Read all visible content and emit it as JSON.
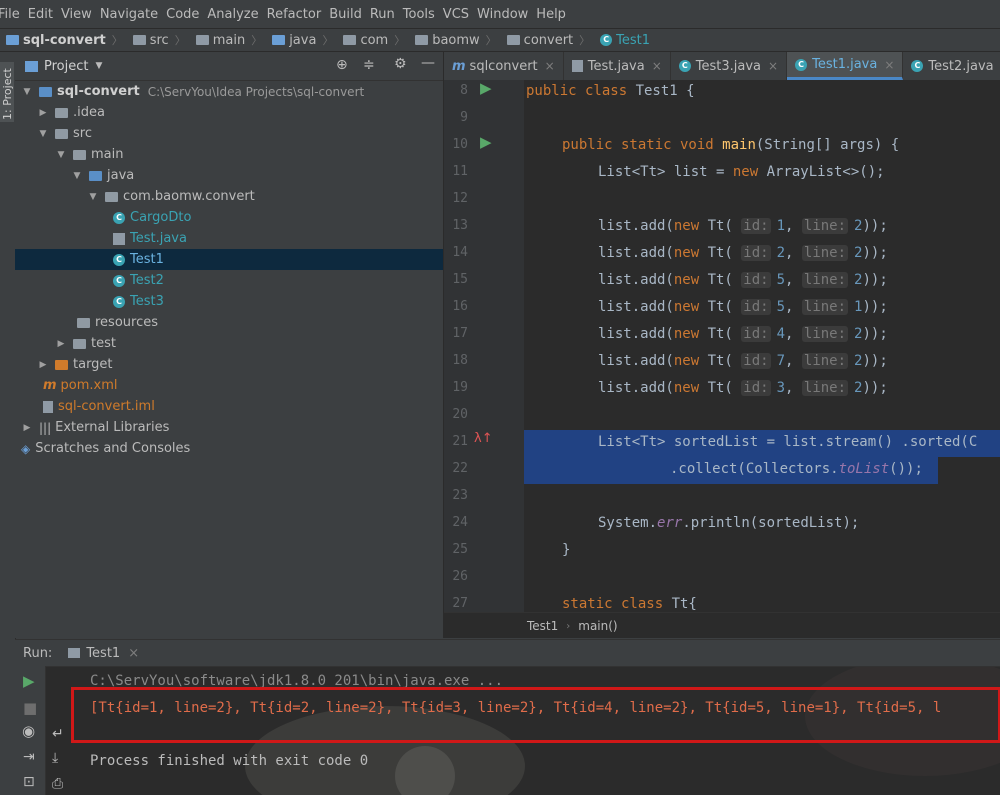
{
  "menu": [
    "File",
    "Edit",
    "View",
    "Navigate",
    "Code",
    "Analyze",
    "Refactor",
    "Build",
    "Run",
    "Tools",
    "VCS",
    "Window",
    "Help"
  ],
  "breadcrumb": [
    "sql-convert",
    "src",
    "main",
    "java",
    "com",
    "baomw",
    "convert",
    "Test1"
  ],
  "left_strip": {
    "project_tab": "1: Project"
  },
  "project_panel": {
    "title": "Project",
    "tree": [
      {
        "label": "sql-convert",
        "extra": "C:\\ServYou\\Idea Projects\\sql-convert"
      },
      {
        "label": ".idea"
      },
      {
        "label": "src"
      },
      {
        "label": "main"
      },
      {
        "label": "java"
      },
      {
        "label": "com.baomw.convert"
      },
      {
        "label": "CargoDto"
      },
      {
        "label": "Test.java"
      },
      {
        "label": "Test1"
      },
      {
        "label": "Test2"
      },
      {
        "label": "Test3"
      },
      {
        "label": "resources"
      },
      {
        "label": "test"
      },
      {
        "label": "target"
      },
      {
        "label": "pom.xml"
      },
      {
        "label": "sql-convert.iml"
      },
      {
        "label": "External Libraries"
      },
      {
        "label": "Scratches and Consoles"
      }
    ]
  },
  "editor": {
    "tabs": [
      "sqlconvert",
      "Test.java",
      "Test3.java",
      "Test1.java",
      "Test2.java"
    ],
    "active_tab": "Test1.java",
    "line_numbers": [
      "8",
      "9",
      "10",
      "11",
      "12",
      "13",
      "14",
      "15",
      "16",
      "17",
      "18",
      "19",
      "20",
      "21",
      "22",
      "23",
      "24",
      "25",
      "26",
      "27"
    ],
    "code": {
      "l8_kw": "public class ",
      "l8_name": "Test1 {",
      "l10_kw": "public static void ",
      "l10_fn": "main",
      "l10_rest": "(String[] args) {",
      "l11_a": "List<Tt> list = ",
      "l11_kw": "new ",
      "l11_b": "ArrayList<>();",
      "add_prefix": "list.add(",
      "new_kw": "new ",
      "tt": "Tt( ",
      "hint_id": "id:",
      "hint_line": "line:",
      "adds": [
        {
          "id": "1",
          "line": "2"
        },
        {
          "id": "2",
          "line": "2"
        },
        {
          "id": "5",
          "line": "2"
        },
        {
          "id": "5",
          "line": "1"
        },
        {
          "id": "4",
          "line": "2"
        },
        {
          "id": "7",
          "line": "2"
        },
        {
          "id": "3",
          "line": "2"
        }
      ],
      "add_suffix": "));",
      "l21": "List<Tt> sortedList = list.stream() .sorted(C",
      "l22_a": ".collect(Collectors.",
      "l22_st": "toList",
      "l22_b": "());",
      "l24_a": "System.",
      "l24_st": "err",
      "l24_b": ".println(sortedList);",
      "l25": "}",
      "l27_kw": "static class ",
      "l27_rest": "Tt{"
    },
    "breadcrumb": [
      "Test1",
      "main()"
    ]
  },
  "run": {
    "label": "Run:",
    "tab": "Test1",
    "command": "C:\\ServYou\\software\\jdk1.8.0_201\\bin\\java.exe ...",
    "output": "[Tt{id=1, line=2}, Tt{id=2, line=2}, Tt{id=3, line=2}, Tt{id=4, line=2}, Tt{id=5, line=1}, Tt{id=5, l",
    "exit": "Process finished with exit code 0"
  },
  "colors": {
    "highlight_box": "#d01818",
    "selection": "#214283",
    "accent": "#4a88c7"
  }
}
